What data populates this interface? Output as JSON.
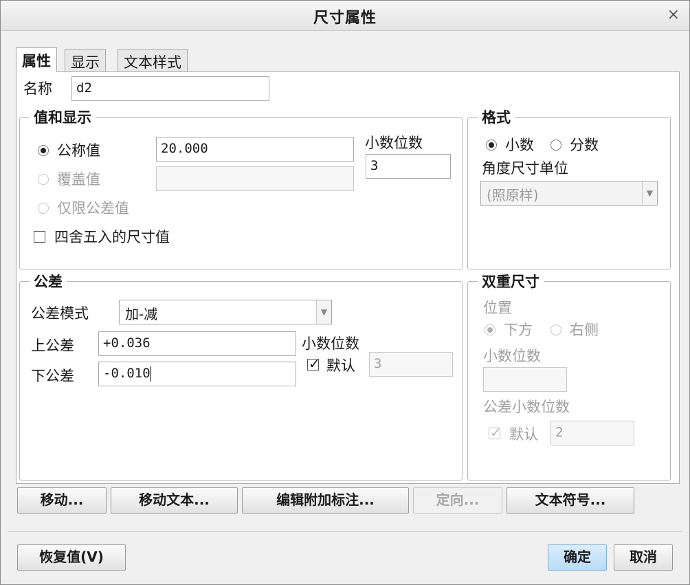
{
  "dialog": {
    "title": "尺寸属性",
    "close": "×"
  },
  "tabs": [
    {
      "label": "属性",
      "active": true
    },
    {
      "label": "显示",
      "active": false
    },
    {
      "label": "文本样式",
      "active": false
    }
  ],
  "name": {
    "label": "名称",
    "value": "d2"
  },
  "value_display": {
    "title": "值和显示",
    "nominal": {
      "label": "公称值",
      "value": "20.000",
      "selected": true
    },
    "override": {
      "label": "覆盖值",
      "value": "",
      "enabled": false
    },
    "tolerance_only": {
      "label": "仅限公差值",
      "enabled": false
    },
    "round": {
      "label": "四舍五入的尺寸值",
      "checked": false
    },
    "decimals": {
      "label": "小数位数",
      "value": "3"
    }
  },
  "format": {
    "title": "格式",
    "decimal": {
      "label": "小数",
      "selected": true
    },
    "fraction": {
      "label": "分数",
      "selected": false
    },
    "angle_unit_label": "角度尺寸单位",
    "angle_unit_value": "(照原样)"
  },
  "tolerance": {
    "title": "公差",
    "mode_label": "公差模式",
    "mode_value": "加-减",
    "upper_label": "上公差",
    "upper_value": "+0.036",
    "lower_label": "下公差",
    "lower_value": "-0.010",
    "decimals_label": "小数位数",
    "default_label": "默认",
    "default_checked": true,
    "decimals_value": "3"
  },
  "dual": {
    "title": "双重尺寸",
    "position_label": "位置",
    "below": {
      "label": "下方",
      "selected": true
    },
    "right": {
      "label": "右侧",
      "selected": false
    },
    "decimals_label": "小数位数",
    "decimals_value": "",
    "tol_decimals_label": "公差小数位数",
    "default_label": "默认",
    "tol_decimals_value": "2"
  },
  "buttons": {
    "move": "移动...",
    "move_text": "移动文本...",
    "edit_note": "编辑附加标注...",
    "orient": "定向...",
    "text_symbol": "文本符号...",
    "restore": "恢复值(V)",
    "ok": "确定",
    "cancel": "取消"
  }
}
